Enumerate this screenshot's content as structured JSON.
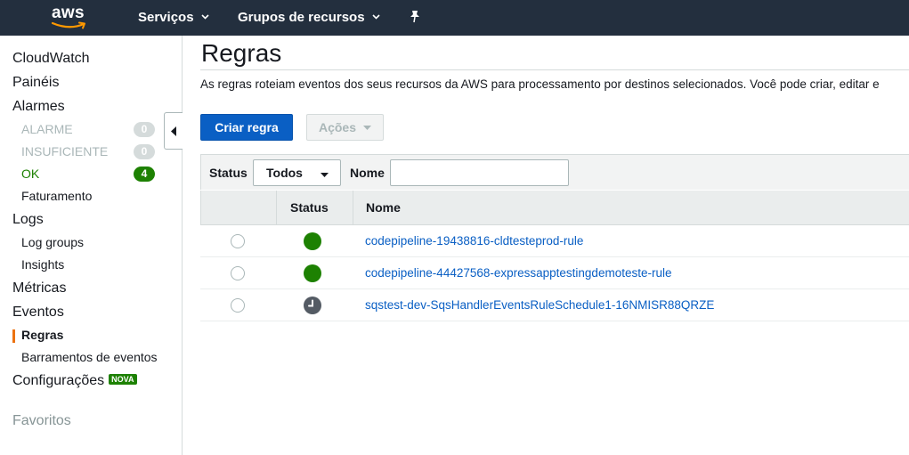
{
  "topbar": {
    "logo_text": "aws",
    "services_label": "Serviços",
    "resource_groups_label": "Grupos de recursos"
  },
  "sidebar": {
    "cloudwatch": "CloudWatch",
    "dashboards": "Painéis",
    "alarms": "Alarmes",
    "alarm_items": [
      {
        "label": "ALARME",
        "count": "0"
      },
      {
        "label": "INSUFICIENTE",
        "count": "0"
      },
      {
        "label": "OK",
        "count": "4"
      }
    ],
    "billing": "Faturamento",
    "logs": "Logs",
    "log_groups": "Log groups",
    "insights": "Insights",
    "metrics": "Métricas",
    "events": "Eventos",
    "rules": "Regras",
    "event_buses": "Barramentos de eventos",
    "settings": "Configurações",
    "settings_badge": "NOVA",
    "favorites": "Favoritos"
  },
  "main": {
    "title": "Regras",
    "description": "As regras roteiam eventos dos seus recursos da AWS para processamento por destinos selecionados. Você pode criar, editar e",
    "create_button": "Criar regra",
    "actions_button": "Ações",
    "filter": {
      "status_label": "Status",
      "status_value": "Todos",
      "name_label": "Nome",
      "name_value": ""
    },
    "table": {
      "headers": [
        "Status",
        "Nome"
      ],
      "rows": [
        {
          "status": "ok",
          "name": "codepipeline-19438816-cldtesteprod-rule"
        },
        {
          "status": "ok",
          "name": "codepipeline-44427568-expressapptestingdemoteste-rule"
        },
        {
          "status": "scheduled",
          "name": "sqstest-dev-SqsHandlerEventsRuleSchedule1-16NMISR88QRZE"
        }
      ]
    }
  },
  "colors": {
    "topbar": "#232f3e",
    "primary": "#0a5fc4",
    "success": "#1d8102",
    "accent": "#ec7211"
  }
}
